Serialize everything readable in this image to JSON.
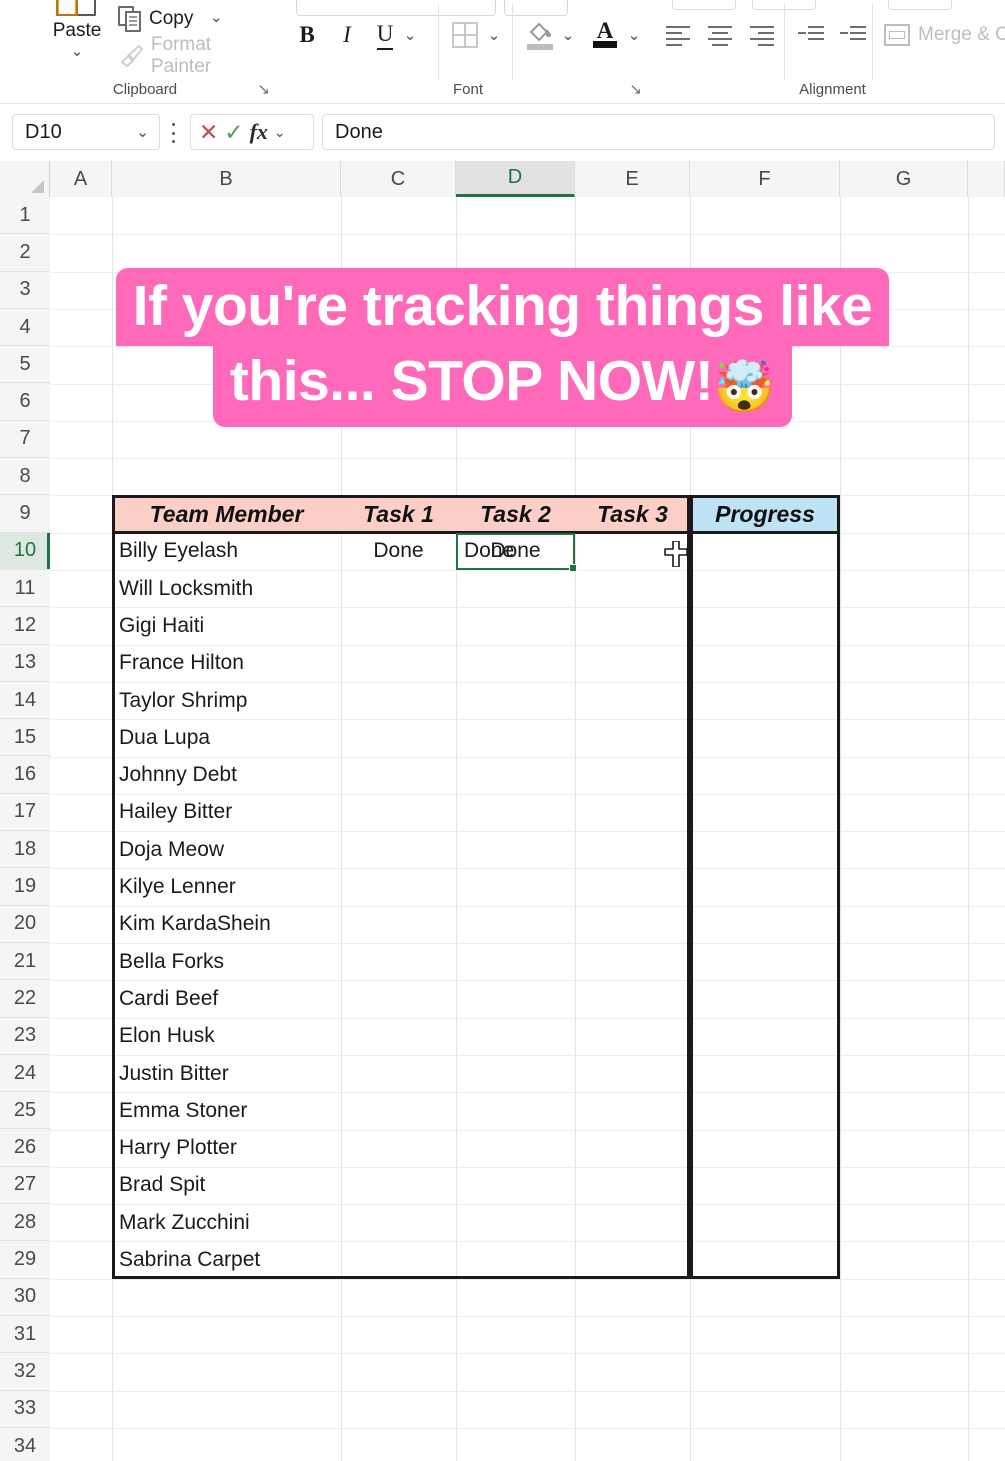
{
  "ribbon": {
    "clipboard": {
      "group_label": "Clipboard",
      "paste_label": "Paste",
      "copy_label": "Copy",
      "format_painter_label": "Format Painter"
    },
    "font": {
      "group_label": "Font",
      "bold_label": "B",
      "italic_label": "I",
      "underline_label": "U"
    },
    "alignment": {
      "group_label": "Alignment",
      "merge_label": "Merge & Ce"
    }
  },
  "formula_bar": {
    "name_box_value": "D10",
    "formula_value": "Done",
    "fx_label": "fx",
    "cancel_glyph": "✕",
    "enter_glyph": "✓"
  },
  "grid": {
    "columns": [
      "A",
      "B",
      "C",
      "D",
      "E",
      "F",
      "G"
    ],
    "selected_column": "D",
    "selected_row": 10,
    "selected_cell": "D10",
    "rows": [
      1,
      2,
      3,
      4,
      5,
      6,
      7,
      8,
      9,
      10,
      11,
      12,
      13,
      14,
      15,
      16,
      17,
      18,
      19,
      20,
      21,
      22,
      23,
      24,
      25,
      26,
      27,
      28,
      29,
      30,
      31,
      32,
      33,
      34
    ]
  },
  "table": {
    "headers": [
      "Team Member",
      "Task 1",
      "Task 2",
      "Task 3",
      "Progress"
    ],
    "header_fill_tasks": "#fbcfc8",
    "header_fill_progress": "#bde3f5",
    "rows": [
      {
        "row": 10,
        "name": "Billy Eyelash",
        "task1": "Done",
        "task2": "Done",
        "task3": "",
        "progress": ""
      },
      {
        "row": 11,
        "name": "Will Locksmith",
        "task1": "",
        "task2": "",
        "task3": "",
        "progress": ""
      },
      {
        "row": 12,
        "name": "Gigi Haiti",
        "task1": "",
        "task2": "",
        "task3": "",
        "progress": ""
      },
      {
        "row": 13,
        "name": "France Hilton",
        "task1": "",
        "task2": "",
        "task3": "",
        "progress": ""
      },
      {
        "row": 14,
        "name": "Taylor Shrimp",
        "task1": "",
        "task2": "",
        "task3": "",
        "progress": ""
      },
      {
        "row": 15,
        "name": "Dua Lupa",
        "task1": "",
        "task2": "",
        "task3": "",
        "progress": ""
      },
      {
        "row": 16,
        "name": "Johnny Debt",
        "task1": "",
        "task2": "",
        "task3": "",
        "progress": ""
      },
      {
        "row": 17,
        "name": "Hailey Bitter",
        "task1": "",
        "task2": "",
        "task3": "",
        "progress": ""
      },
      {
        "row": 18,
        "name": "Doja Meow",
        "task1": "",
        "task2": "",
        "task3": "",
        "progress": ""
      },
      {
        "row": 19,
        "name": "Kilye Lenner",
        "task1": "",
        "task2": "",
        "task3": "",
        "progress": ""
      },
      {
        "row": 20,
        "name": "Kim KardaShein",
        "task1": "",
        "task2": "",
        "task3": "",
        "progress": ""
      },
      {
        "row": 21,
        "name": "Bella Forks",
        "task1": "",
        "task2": "",
        "task3": "",
        "progress": ""
      },
      {
        "row": 22,
        "name": "Cardi Beef",
        "task1": "",
        "task2": "",
        "task3": "",
        "progress": ""
      },
      {
        "row": 23,
        "name": "Elon Husk",
        "task1": "",
        "task2": "",
        "task3": "",
        "progress": ""
      },
      {
        "row": 24,
        "name": "Justin Bitter",
        "task1": "",
        "task2": "",
        "task3": "",
        "progress": ""
      },
      {
        "row": 25,
        "name": "Emma Stoner",
        "task1": "",
        "task2": "",
        "task3": "",
        "progress": ""
      },
      {
        "row": 26,
        "name": "Harry Plotter",
        "task1": "",
        "task2": "",
        "task3": "",
        "progress": ""
      },
      {
        "row": 27,
        "name": "Brad Spit",
        "task1": "",
        "task2": "",
        "task3": "",
        "progress": ""
      },
      {
        "row": 28,
        "name": "Mark Zucchini",
        "task1": "",
        "task2": "",
        "task3": "",
        "progress": ""
      },
      {
        "row": 29,
        "name": "Sabrina Carpet",
        "task1": "",
        "task2": "",
        "task3": "",
        "progress": ""
      }
    ]
  },
  "caption": {
    "line1": "If you're tracking things like",
    "line2": "this... STOP NOW!",
    "emoji": "🤯",
    "background": "#ff69b9",
    "text_color": "#ffffff"
  },
  "colors": {
    "excel_green": "#217346",
    "header_pink": "#fbcfc8",
    "header_blue": "#bde3f5",
    "banner_pink": "#ff69b9"
  }
}
